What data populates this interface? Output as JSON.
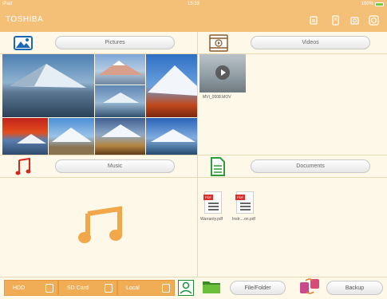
{
  "status": {
    "device": "iPad",
    "time": "15:33",
    "battery": "100%"
  },
  "header": {
    "title": "TOSHIBA"
  },
  "sections": {
    "pictures": {
      "label": "Pictures"
    },
    "videos": {
      "label": "Videos",
      "items": [
        {
          "name": "MVI_0008.MOV"
        }
      ]
    },
    "music": {
      "label": "Music"
    },
    "documents": {
      "label": "Documents",
      "items": [
        {
          "name": "Warranty.pdf"
        },
        {
          "name": "Instr....on.pdf"
        }
      ]
    }
  },
  "storage_tabs": [
    {
      "label": "HDD"
    },
    {
      "label": "SD Card"
    },
    {
      "label": "Local"
    }
  ],
  "bottom": {
    "file_folder": "File/Folder",
    "backup": "Backup"
  },
  "colors": {
    "accent": "#f4c078",
    "tab": "#f0ad55",
    "music": "#f2a84a"
  }
}
